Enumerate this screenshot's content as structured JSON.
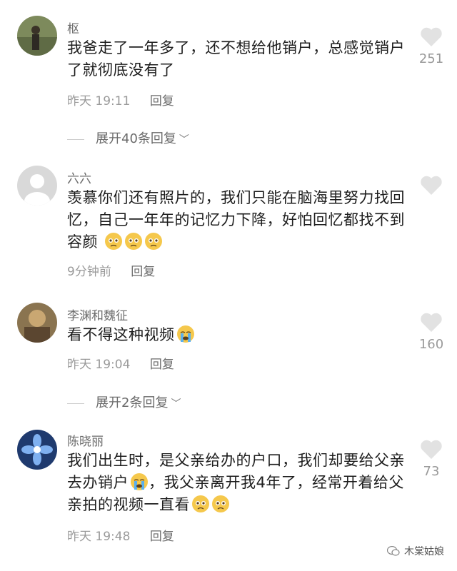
{
  "comments": [
    {
      "username": "枢",
      "text": "我爸走了一年多了，还不想给他销户，总感觉销户了就彻底没有了",
      "time": "昨天 19:11",
      "reply_label": "回复",
      "likes": "251",
      "expand": "展开40条回复"
    },
    {
      "username": "六六",
      "text": "羡慕你们还有照片的，我们只能在脑海里努力找回忆，自己一年年的记忆力下降，好怕回忆都找不到容颜",
      "emojis": [
        "pleading-emoji",
        "pleading-emoji",
        "pleading-emoji"
      ],
      "time": "9分钟前",
      "reply_label": "回复",
      "likes": ""
    },
    {
      "username": "李渊和魏征",
      "text": "看不得这种视频",
      "emojis": [
        "crying-emoji"
      ],
      "time": "昨天 19:04",
      "reply_label": "回复",
      "likes": "160",
      "expand": "展开2条回复"
    },
    {
      "username": "陈晓丽",
      "text_part1": "我们出生时，是父亲给办的户口，我们却要给父亲去办销户",
      "text_part2": "，我父亲离开我4年了，经常开着给父亲拍的视频一直看",
      "emojis_mid": [
        "crying-emoji"
      ],
      "emojis_end": [
        "pleading-emoji",
        "pleading-emoji"
      ],
      "time": "昨天 19:48",
      "reply_label": "回复",
      "likes": "73"
    }
  ],
  "watermark": "木棠姑娘",
  "colors": {
    "text": "#1d1d1d",
    "secondary": "#9a9a9a",
    "heart": "#e2e2e2"
  }
}
